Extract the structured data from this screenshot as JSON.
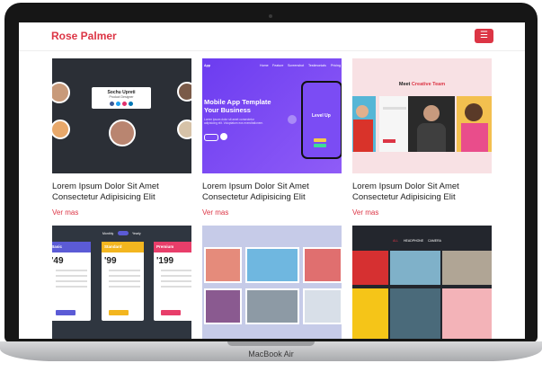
{
  "header": {
    "brand": "Rose Palmer",
    "menu_icon": "hamburger-icon"
  },
  "device_label": "MacBook Air",
  "cards": [
    {
      "title": "Lorem Ipsum Dolor Sit Amet Consectetur Adipisicing Elit",
      "link": "Ver mas",
      "thumb": {
        "name": "Sochu Upreti",
        "role": "Product Designer"
      }
    },
    {
      "title": "Lorem Ipsum Dolor Sit Amet Consectetur Adipisicing Elit",
      "link": "Ver mas",
      "thumb": {
        "logo": "App",
        "nav": [
          "Home",
          "Feature",
          "Screenshot",
          "Testimonials",
          "Pricing"
        ],
        "headline": "Mobile App Template\nYour Business",
        "body": "Lorem ipsum dolor sit amet consectetur adipisicing elit. Voluptatum eos exercitationem.",
        "phone_text": "Level Up"
      }
    },
    {
      "title": "Lorem Ipsum Dolor Sit Amet Consectetur Adipisicing Elit",
      "link": "Ver mas",
      "thumb": {
        "heading_plain": "Meet ",
        "heading_accent": "Creative Team"
      }
    },
    {
      "title": "",
      "link": "",
      "thumb": {
        "toggle_left": "Monthly",
        "toggle_right": "Yearly",
        "plans": [
          {
            "name": "Basic",
            "price": "49",
            "color": "#5b5bd6"
          },
          {
            "name": "Standard",
            "price": "99",
            "color": "#f3b61f"
          },
          {
            "name": "Premium",
            "price": "199",
            "color": "#e83e6a"
          }
        ]
      }
    },
    {
      "title": "",
      "link": "",
      "thumb": {}
    },
    {
      "title": "",
      "link": "",
      "thumb": {
        "nav": [
          "ALL",
          "HEADPHONE",
          "CAMERA"
        ]
      }
    }
  ]
}
